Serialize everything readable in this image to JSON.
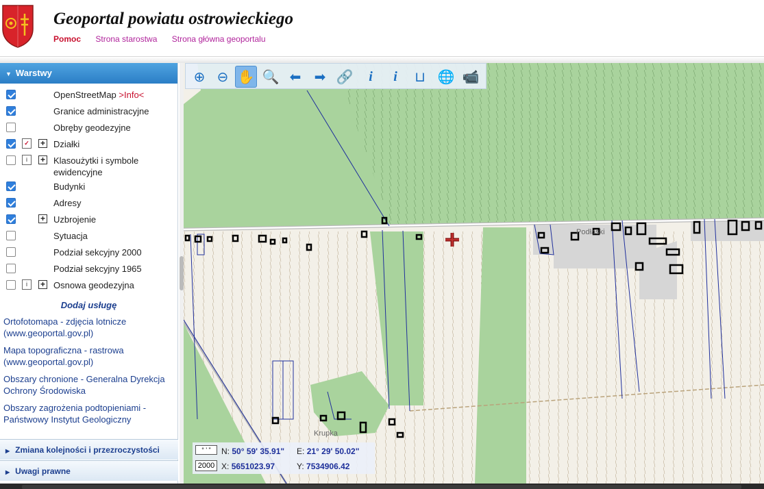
{
  "header": {
    "title": "Geoportal powiatu ostrowieckiego",
    "links": {
      "help": "Pomoc",
      "district": "Strona starostwa",
      "main": "Strona główna geoportalu"
    }
  },
  "sidebar": {
    "layers_title": "Warstwy",
    "layers": [
      {
        "label": "OpenStreetMap",
        "extra": ">Info<",
        "checked": true
      },
      {
        "label": "Granice administracyjne",
        "checked": true
      },
      {
        "label": "Obręby geodezyjne",
        "checked": false
      },
      {
        "label": "Działki",
        "checked": true,
        "legend_icon": "edit-legend-icon",
        "expandable": true
      },
      {
        "label": "Klasoużytki i symbole ewidencyjne",
        "checked": false,
        "legend_icon": "info-legend-icon",
        "expandable": true
      },
      {
        "label": "Budynki",
        "checked": true
      },
      {
        "label": "Adresy",
        "checked": true
      },
      {
        "label": "Uzbrojenie",
        "checked": true,
        "expandable": true
      },
      {
        "label": "Sytuacja",
        "checked": false
      },
      {
        "label": "Podział sekcyjny 2000",
        "checked": false
      },
      {
        "label": "Podział sekcyjny 1965",
        "checked": false
      },
      {
        "label": "Osnowa geodezyjna",
        "checked": false,
        "legend_icon": "info-legend-icon",
        "expandable": true
      }
    ],
    "add_service": "Dodaj usługę",
    "services": [
      "Ortofotomapa - zdjęcia lotnicze (www.geoportal.gov.pl)",
      "Mapa topograficzna - rastrowa (www.geoportal.gov.pl)",
      "Obszary chronione - Generalna Dyrekcja Ochrony Środowiska",
      "Obszary zagrożenia podtopieniami - Państwowy Instytut Geologiczny"
    ],
    "panel_order": "Zmiana kolejności i przezroczystości",
    "panel_legal": "Uwagi prawne"
  },
  "toolbar": [
    "zoom-in-icon",
    "zoom-out-icon",
    "pan-hand-icon",
    "zoom-box-icon",
    "back-arrow-icon",
    "forward-arrow-icon",
    "link-icon",
    "info-icon",
    "info-query-icon",
    "measure-icon",
    "globe-icon",
    "camera-icon"
  ],
  "map": {
    "place_1": "Podłaski",
    "place_2": "Krupka",
    "colors": {
      "forest": "#a9d39d",
      "farmland": "#f3f0e8",
      "parcel": "#1f2f9c",
      "road": "#b9b9b9"
    }
  },
  "coords": {
    "format_label": "° ' \"",
    "system_label": "2000",
    "n_label": "N:",
    "n_value": "50° 59' 35.91\"",
    "e_label": "E:",
    "e_value": "21° 29' 50.02\"",
    "x_label": "X:",
    "x_value": "5651023.97",
    "y_label": "Y:",
    "y_value": "7534906.42"
  }
}
